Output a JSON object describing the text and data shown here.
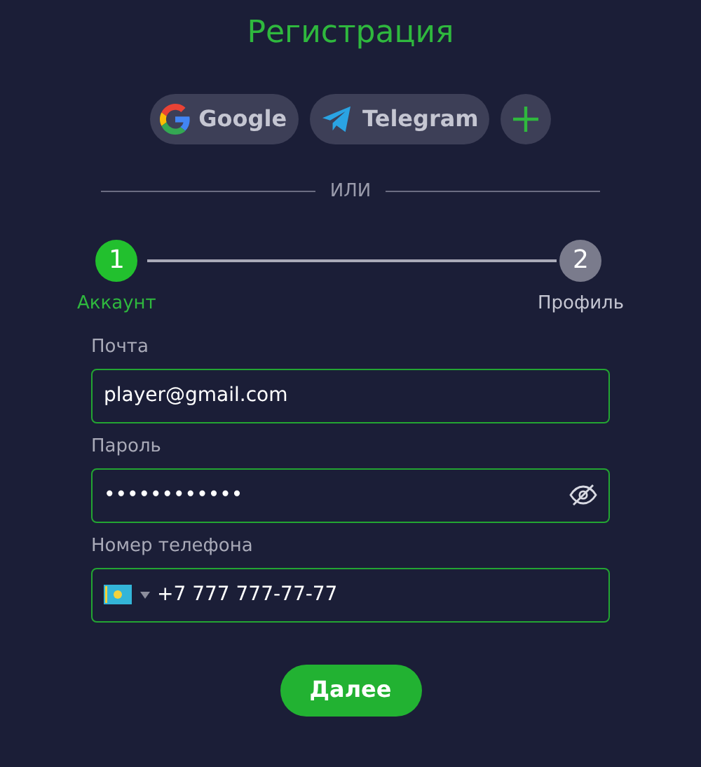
{
  "title": "Регистрация",
  "social_buttons": [
    {
      "kind": "google",
      "label": "Google"
    },
    {
      "kind": "telegram",
      "label": "Telegram"
    },
    {
      "kind": "more"
    }
  ],
  "divider": "ИЛИ",
  "steps": [
    {
      "number": "1",
      "label": "Аккаунт",
      "selected": true
    },
    {
      "number": "2",
      "label": "Профиль",
      "selected": false
    }
  ],
  "fields": [
    {
      "kind": "text",
      "label": "Почта",
      "value": "player@gmail.com"
    },
    {
      "kind": "password",
      "label": "Пароль",
      "value": "••••••••••••"
    },
    {
      "kind": "phone",
      "label": "Номер телефона",
      "value": "+7 777 777-77-77"
    }
  ],
  "submit": "Далее"
}
